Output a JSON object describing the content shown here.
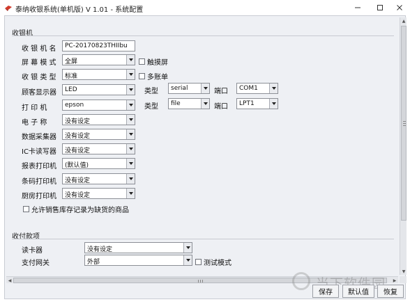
{
  "window": {
    "title": "泰纳收银系统(单机版) V 1.01 - 系统配置",
    "minimize_icon": "minimize-icon",
    "maximize_icon": "maximize-icon",
    "close_icon": "close-icon"
  },
  "cashier_section": {
    "title": "收银机",
    "rows": [
      {
        "label": "收 银 机 名",
        "value": "PC-20170823THIIbu",
        "kind": "text"
      },
      {
        "label": "屏 幕 模 式",
        "value": "全屏",
        "kind": "select"
      },
      {
        "label": "收 银 类 型",
        "value": "标准",
        "kind": "select"
      },
      {
        "label": "顾客显示器",
        "value": "LED",
        "kind": "select"
      },
      {
        "label": "打  印  机",
        "value": "epson",
        "kind": "select"
      },
      {
        "label": "电  子  称",
        "value": "没有设定",
        "kind": "select"
      },
      {
        "label": "数据采集器",
        "value": "没有设定",
        "kind": "select"
      },
      {
        "label": "IC卡读写器",
        "value": "没有设定",
        "kind": "select"
      },
      {
        "label": "报表打印机",
        "value": "(默认值)",
        "kind": "select"
      },
      {
        "label": "条码打印机",
        "value": "没有设定",
        "kind": "select"
      },
      {
        "label": "厨房打印机",
        "value": "没有设定",
        "kind": "select"
      }
    ],
    "touch_screen_label": "触摸屏",
    "multi_order_label": "多账单",
    "display_type_label": "类型",
    "display_type_value": "serial",
    "display_port_label": "端口",
    "display_port_value": "COM1",
    "printer_type_label": "类型",
    "printer_type_value": "file",
    "printer_port_label": "端口",
    "printer_port_value": "LPT1",
    "allow_negative_label": "允许销售库存记录为缺货的商品"
  },
  "payment_section": {
    "title": "收付款项",
    "card_reader_label": "读卡器",
    "card_reader_value": "没有设定",
    "gateway_label": "支付网关",
    "gateway_value": "外部",
    "test_mode_label": "测试模式"
  },
  "buttons": {
    "save": "保存",
    "default": "默认值",
    "restore": "恢复"
  },
  "watermark": {
    "text": "当下软件园"
  }
}
